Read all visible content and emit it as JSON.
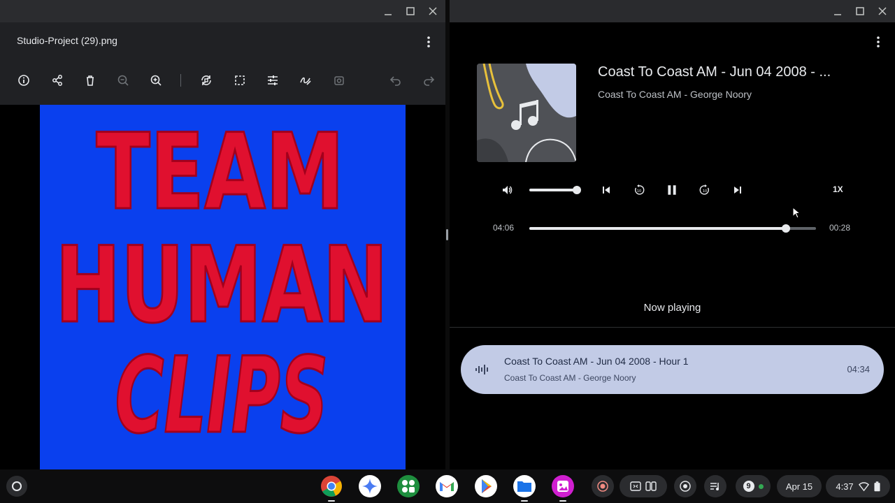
{
  "gallery": {
    "file_name": "Studio-Project (29).png",
    "toolbar_icons": [
      "info-icon",
      "share-icon",
      "delete-icon",
      "zoom-out-icon",
      "zoom-in-icon",
      "rotate-icon",
      "crop-icon",
      "adjust-icon",
      "annotate-icon",
      "lighting-icon",
      "undo-icon",
      "redo-icon"
    ],
    "image_text": {
      "line1": "TEAM",
      "line2": "HUMAN",
      "line3": "CLIPS"
    },
    "colors": {
      "image_bg": "#0a40ee",
      "image_text": "#e0102f"
    }
  },
  "player": {
    "title": "Coast To Coast AM - Jun 04 2008 - ...",
    "artist": "Coast To Coast AM - George Noory",
    "volume_level": 1.0,
    "speed": "1X",
    "elapsed": "04:06",
    "remaining": "00:28",
    "progress_fraction": 0.894,
    "now_playing_label": "Now playing",
    "queue": [
      {
        "title": "Coast To Coast AM - Jun 04 2008 - Hour 1",
        "artist": "Coast To Coast AM - George Noory",
        "duration": "04:34"
      }
    ]
  },
  "shelf": {
    "apps": [
      "chrome-icon",
      "gemini-icon",
      "google-sheets-icon",
      "gmail-icon",
      "play-store-icon",
      "files-icon",
      "canvas-app-icon"
    ],
    "screen_capture_icon": "record-icon",
    "tray_icons": [
      "window-split-icon",
      "screen-split-icon",
      "media-control-icon",
      "playlist-icon"
    ],
    "notification_count": "9",
    "date": "Apr 15",
    "time": "4:37"
  }
}
